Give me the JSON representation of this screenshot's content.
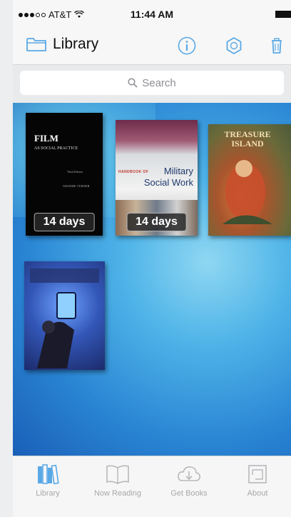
{
  "status_bar": {
    "carrier": "AT&T",
    "time": "11:44 AM"
  },
  "nav": {
    "title": "Library"
  },
  "search": {
    "placeholder": "Search"
  },
  "books": [
    {
      "title": "FILM",
      "subtitle": "AS SOCIAL PRACTICE",
      "edition": "Third Edition",
      "author": "GRAEME TURNER",
      "loan": "14 days"
    },
    {
      "title_prefix": "HANDBOOK OF",
      "title": "Military Social Work",
      "loan": "14 days"
    },
    {
      "title": "TREASURE ISLAND"
    },
    {
      "title": ""
    }
  ],
  "tabs": [
    {
      "label": "Library"
    },
    {
      "label": "Now Reading"
    },
    {
      "label": "Get Books"
    },
    {
      "label": "About"
    }
  ],
  "colors": {
    "accent": "#5aa9e6",
    "tab_active": "#5aa9e6",
    "tab_inactive": "#b8b8ba"
  }
}
